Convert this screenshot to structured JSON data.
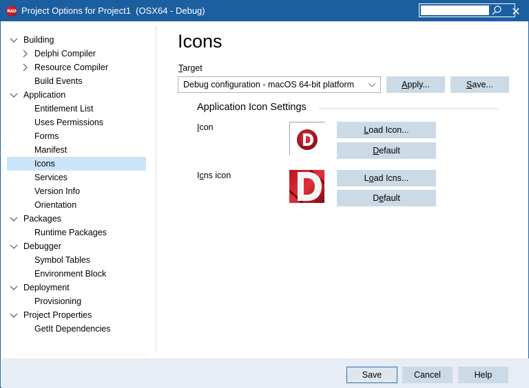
{
  "window": {
    "title": "Project Options for Project1  (OSX64 - Debug)",
    "app_icon_text": "RAD",
    "search": {
      "value": "",
      "placeholder": ""
    },
    "close_glyph": "✕"
  },
  "sidebar": {
    "items": [
      {
        "label": "Building",
        "level": 0,
        "expander": "expanded"
      },
      {
        "label": "Delphi Compiler",
        "level": 1,
        "expander": "collapsed"
      },
      {
        "label": "Resource Compiler",
        "level": 1,
        "expander": "collapsed"
      },
      {
        "label": "Build Events",
        "level": 1,
        "expander": "none"
      },
      {
        "label": "Application",
        "level": 0,
        "expander": "expanded"
      },
      {
        "label": "Entitlement List",
        "level": 1,
        "expander": "none"
      },
      {
        "label": "Uses Permissions",
        "level": 1,
        "expander": "none"
      },
      {
        "label": "Forms",
        "level": 1,
        "expander": "none"
      },
      {
        "label": "Manifest",
        "level": 1,
        "expander": "none"
      },
      {
        "label": "Icons",
        "level": 1,
        "expander": "none",
        "selected": true
      },
      {
        "label": "Services",
        "level": 1,
        "expander": "none"
      },
      {
        "label": "Version Info",
        "level": 1,
        "expander": "none"
      },
      {
        "label": "Orientation",
        "level": 1,
        "expander": "none"
      },
      {
        "label": "Packages",
        "level": 0,
        "expander": "expanded"
      },
      {
        "label": "Runtime Packages",
        "level": 1,
        "expander": "none"
      },
      {
        "label": "Debugger",
        "level": 0,
        "expander": "expanded"
      },
      {
        "label": "Symbol Tables",
        "level": 1,
        "expander": "none"
      },
      {
        "label": "Environment Block",
        "level": 1,
        "expander": "none"
      },
      {
        "label": "Deployment",
        "level": 0,
        "expander": "expanded"
      },
      {
        "label": "Provisioning",
        "level": 1,
        "expander": "none"
      },
      {
        "label": "Project Properties",
        "level": 0,
        "expander": "expanded"
      },
      {
        "label": "GetIt Dependencies",
        "level": 1,
        "expander": "none"
      }
    ]
  },
  "main": {
    "page_title": "Icons",
    "target": {
      "label_accel": "T",
      "label_rest": "arget",
      "selected": "Debug configuration - macOS 64-bit platform",
      "apply_accel": "A",
      "apply_rest": "pply...",
      "save_accel": "S",
      "save_rest": "ave..."
    },
    "group": {
      "title": "Application Icon Settings",
      "icon": {
        "label_accel": "I",
        "label_rest": "con",
        "load_accel": "L",
        "load_rest": "oad Icon...",
        "default_accel": "D",
        "default_rest": "efault",
        "preview_letter": "D"
      },
      "icns": {
        "label_pre": "I",
        "label_accel": "c",
        "label_rest": "ns icon",
        "load_pre": "L",
        "load_accel": "o",
        "load_rest": "ad Icns...",
        "default_pre": "D",
        "default_accel": "e",
        "default_rest": "fault",
        "preview_letter": "D"
      }
    }
  },
  "footer": {
    "save": "Save",
    "cancel": "Cancel",
    "help": "Help"
  },
  "colors": {
    "titlebar": "#1c5fa0",
    "selection": "#cce4f7",
    "button": "#ccdae6",
    "footer": "#e6edf4",
    "brand_red": "#c8102e"
  }
}
